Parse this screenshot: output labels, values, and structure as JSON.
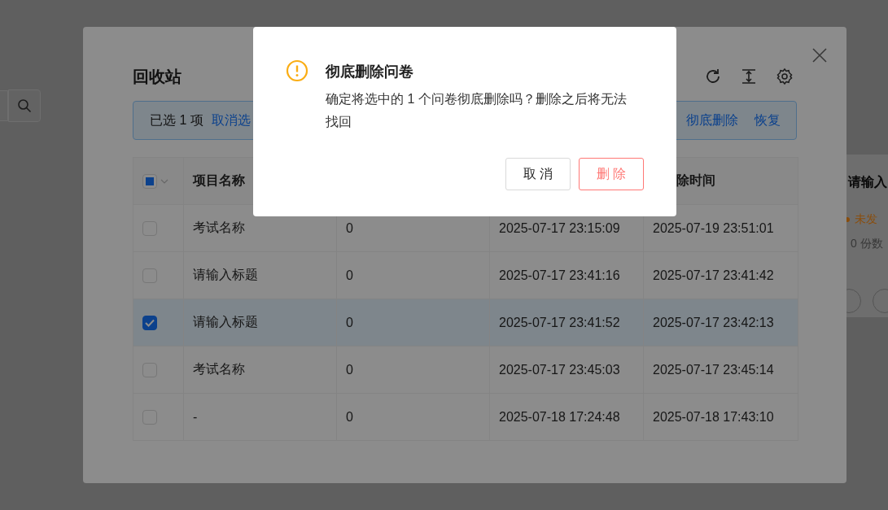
{
  "background_page": {
    "card": {
      "title": "请输入",
      "status": {
        "label": "未发"
      },
      "responses": "0 份数"
    }
  },
  "recycle_bin": {
    "title": "回收站",
    "selection_bar": {
      "selected_text": "已选 1 项",
      "clear_link": "取消选",
      "delete_link": "彻底删除",
      "restore_link": "恢复"
    },
    "table": {
      "header": {
        "select_all_indeterminate": true,
        "column_2": "项目名称",
        "column_5": "除时间"
      },
      "rows": [
        {
          "selected": false,
          "name": "考试名称",
          "column_3": "0",
          "column_4": "2025-07-17 23:15:09",
          "column_5": "2025-07-19 23:51:01"
        },
        {
          "selected": false,
          "name": "请输入标题",
          "column_3": "0",
          "column_4": "2025-07-17 23:41:16",
          "column_5": "2025-07-17 23:41:42"
        },
        {
          "selected": true,
          "name": "请输入标题",
          "column_3": "0",
          "column_4": "2025-07-17 23:41:52",
          "column_5": "2025-07-17 23:42:13"
        },
        {
          "selected": false,
          "name": "考试名称",
          "column_3": "0",
          "column_4": "2025-07-17 23:45:03",
          "column_5": "2025-07-17 23:45:14"
        },
        {
          "selected": false,
          "name": "-",
          "column_3": "0",
          "column_4": "2025-07-18 17:24:48",
          "column_5": "2025-07-18 17:43:10"
        }
      ]
    }
  },
  "confirm_dialog": {
    "title": "彻底删除问卷",
    "message": "确定将选中的 1 个问卷彻底删除吗？删除之后将无法找回",
    "buttons": [
      {
        "label": "取 消",
        "kind": "default"
      },
      {
        "label": "删 除",
        "kind": "danger"
      }
    ]
  }
}
